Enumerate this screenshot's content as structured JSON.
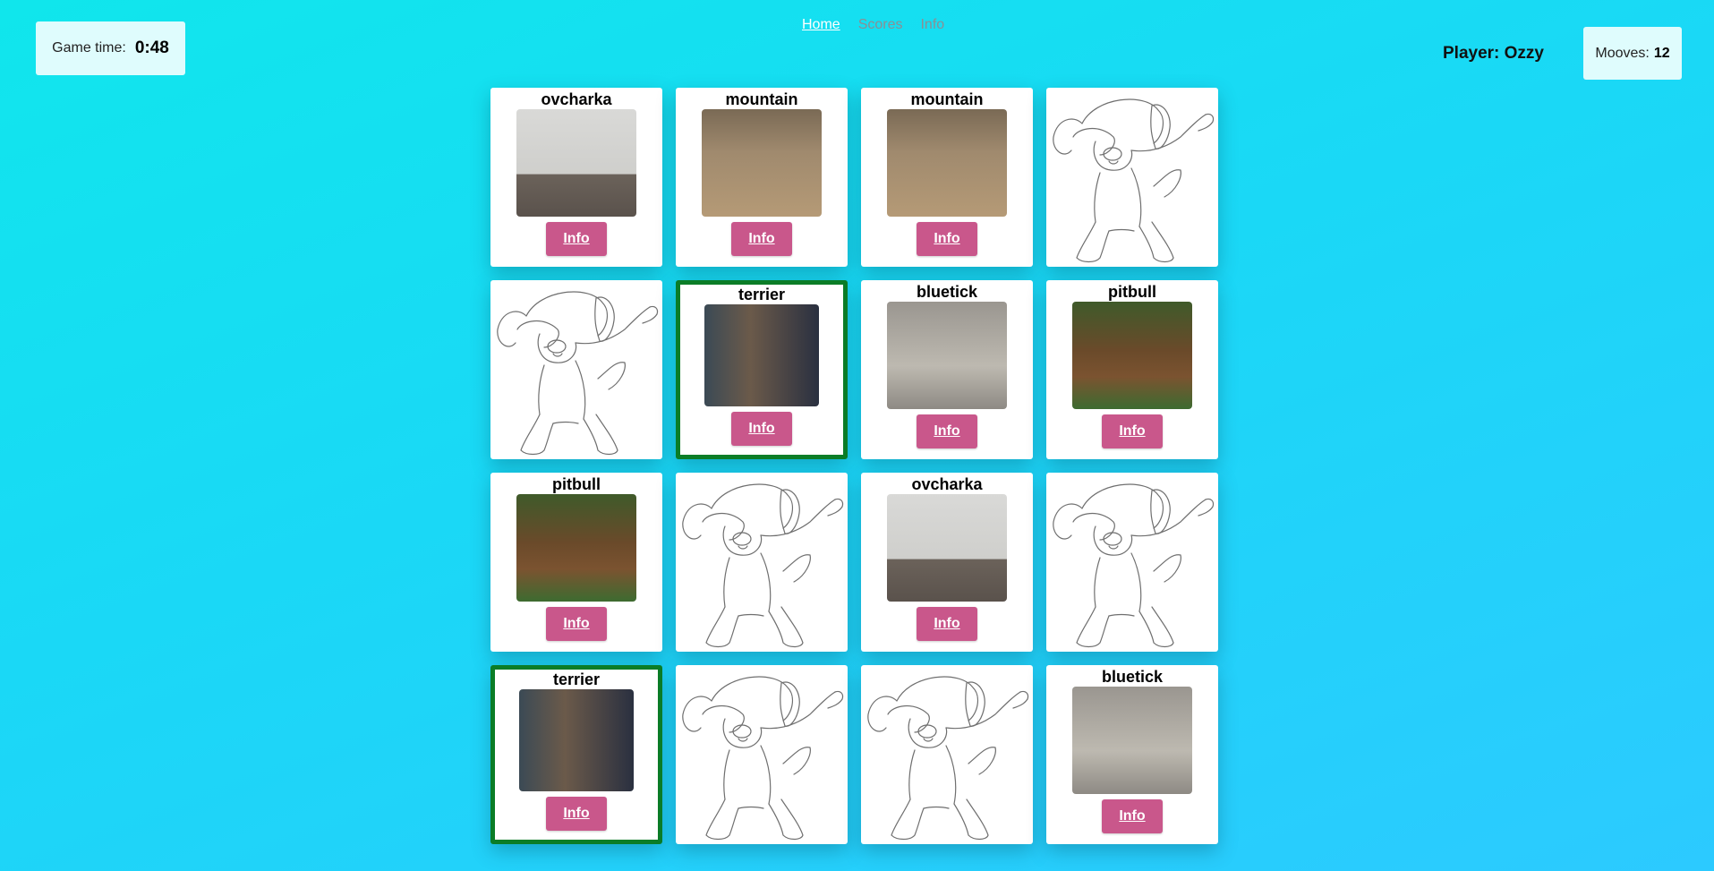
{
  "header": {
    "game_time_label": "Game time:",
    "game_time_value": "0:48",
    "nav": [
      "Home",
      "Scores",
      "Info"
    ],
    "player": "Player: Ozzy",
    "moves_label": "Mooves:",
    "moves_value": "12"
  },
  "cards": [
    {
      "state": "open",
      "name": "ovcharka",
      "button": "Info"
    },
    {
      "state": "open",
      "name": "mountain",
      "button": "Info"
    },
    {
      "state": "open",
      "name": "mountain",
      "button": "Info"
    },
    {
      "state": "closed"
    },
    {
      "state": "closed"
    },
    {
      "state": "matched",
      "name": "terrier",
      "button": "Info"
    },
    {
      "state": "open",
      "name": "bluetick",
      "button": "Info"
    },
    {
      "state": "open",
      "name": "pitbull",
      "button": "Info"
    },
    {
      "state": "open",
      "name": "pitbull",
      "button": "Info"
    },
    {
      "state": "closed"
    },
    {
      "state": "open",
      "name": "ovcharka",
      "button": "Info"
    },
    {
      "state": "closed"
    },
    {
      "state": "matched",
      "name": "terrier",
      "button": "Info"
    },
    {
      "state": "closed"
    },
    {
      "state": "closed"
    },
    {
      "state": "open",
      "name": "bluetick",
      "button": "Info"
    }
  ],
  "colors": {
    "matched_border": "#0b7d27",
    "info_button": "#c9578b",
    "active_nav": "#ffffff",
    "inactive_nav": "#8a8f95"
  }
}
